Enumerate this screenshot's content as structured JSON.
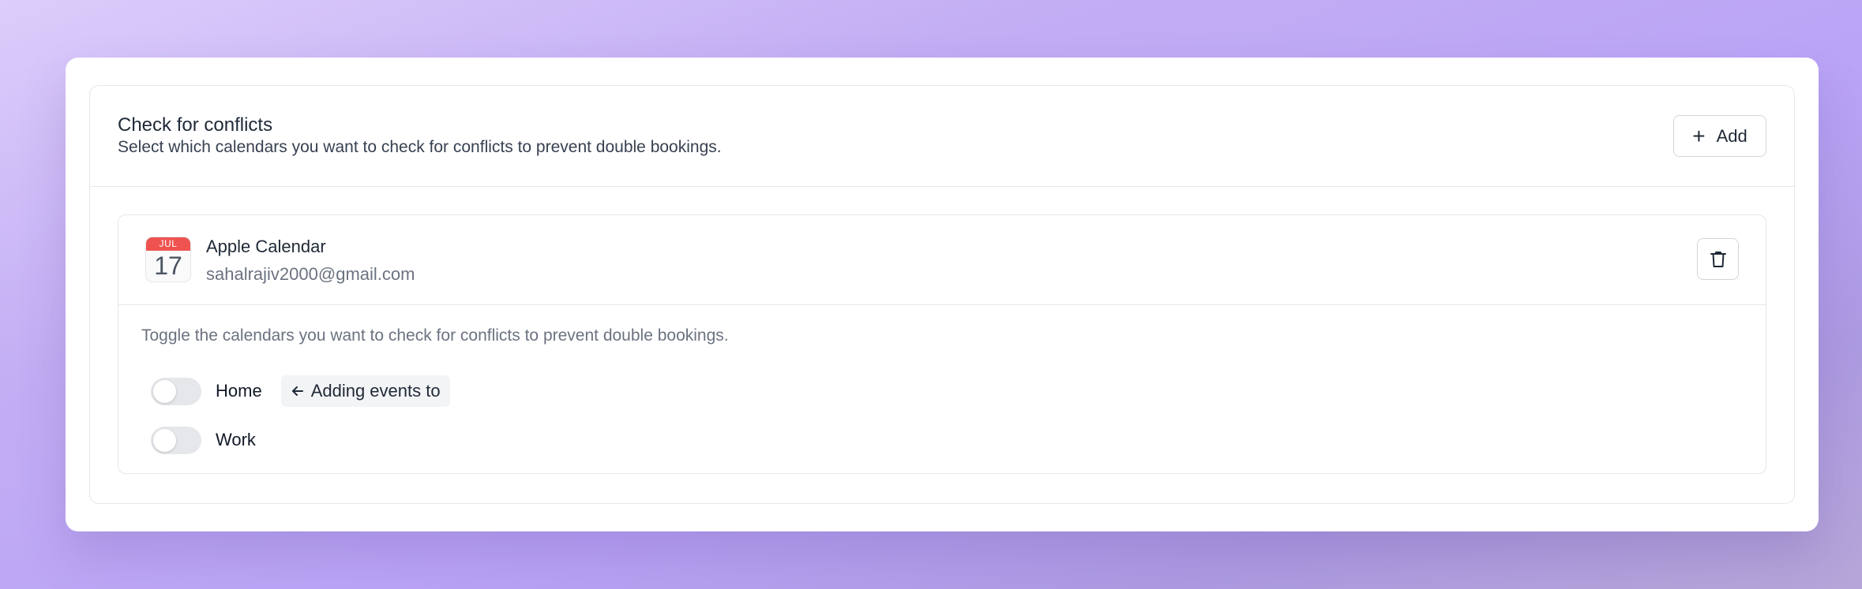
{
  "section": {
    "title": "Check for conflicts",
    "description": "Select which calendars you want to check for conflicts to prevent double bookings.",
    "add_label": "Add"
  },
  "calendar": {
    "icon_month": "JUL",
    "icon_day": "17",
    "name": "Apple Calendar",
    "email": "sahalrajiv2000@gmail.com",
    "toggle_hint": "Toggle the calendars you want to check for conflicts to prevent double bookings.",
    "items": [
      {
        "label": "Home",
        "enabled": false,
        "badge": "Adding events to"
      },
      {
        "label": "Work",
        "enabled": false
      }
    ]
  },
  "colors": {
    "accent_red": "#ef5350",
    "toggle_off": "#e5e7eb"
  },
  "icons": {
    "add": "plus-icon",
    "delete": "trash-icon",
    "badge": "arrow-left-icon"
  }
}
